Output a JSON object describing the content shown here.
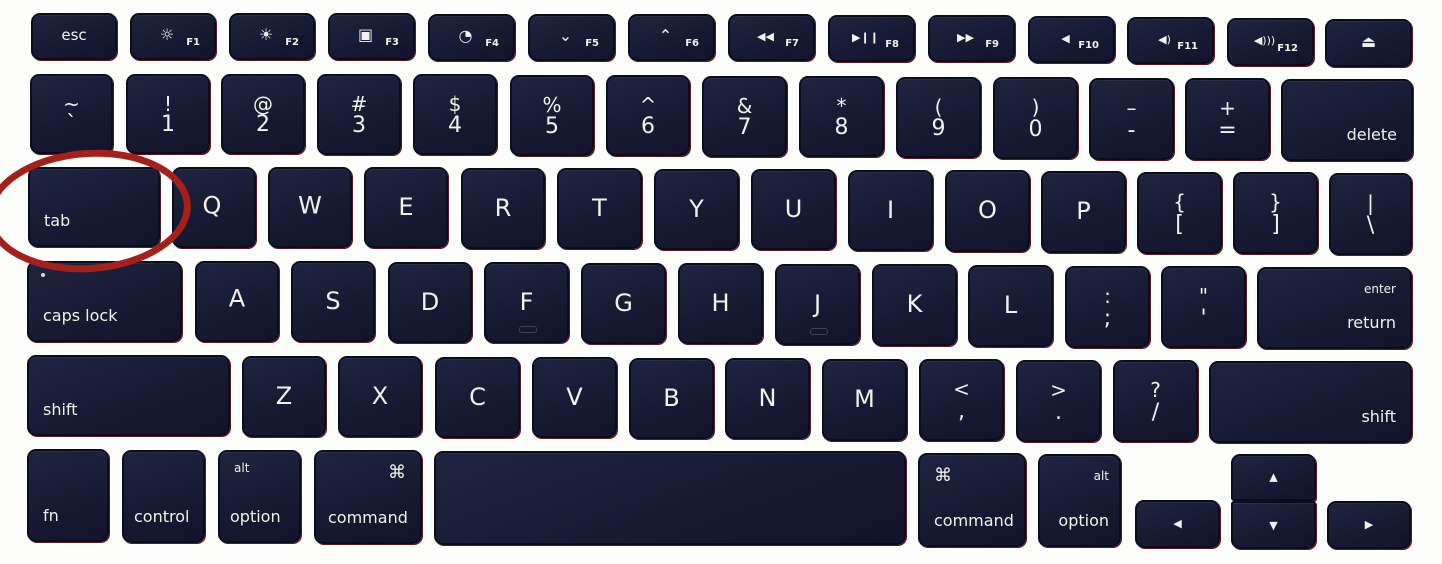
{
  "image": {
    "description": "Apple laptop keyboard (US layout) with the tab key circled in red",
    "highlight": {
      "target": "tab",
      "shape": "ellipse",
      "color": "#a4201c"
    },
    "colors": {
      "key": "#171a33",
      "legend": "#f2f1ec",
      "background": "#fdfdfb"
    }
  },
  "rows": {
    "function": [
      {
        "main": "esc",
        "fn": ""
      },
      {
        "icon": "brightness-down-icon",
        "main": "☼",
        "fn": "F1"
      },
      {
        "icon": "brightness-up-icon",
        "main": "☀",
        "fn": "F2"
      },
      {
        "icon": "expose-icon",
        "main": "▣",
        "fn": "F3"
      },
      {
        "icon": "dashboard-icon",
        "main": "◔",
        "fn": "F4"
      },
      {
        "icon": "keyboard-light-down-icon",
        "main": "⌄",
        "fn": "F5"
      },
      {
        "icon": "keyboard-light-up-icon",
        "main": "⌃",
        "fn": "F6"
      },
      {
        "icon": "rewind-icon",
        "main": "◀◀",
        "fn": "F7"
      },
      {
        "icon": "play-pause-icon",
        "main": "▶❙❙",
        "fn": "F8"
      },
      {
        "icon": "fast-forward-icon",
        "main": "▶▶",
        "fn": "F9"
      },
      {
        "icon": "mute-icon",
        "main": "◀",
        "fn": "F10"
      },
      {
        "icon": "volume-down-icon",
        "main": "◀)",
        "fn": "F11"
      },
      {
        "icon": "volume-up-icon",
        "main": "◀)))",
        "fn": "F12"
      },
      {
        "icon": "eject-icon",
        "main": "⏏",
        "fn": ""
      }
    ],
    "number": [
      {
        "top": "~",
        "bottom": "`"
      },
      {
        "top": "!",
        "bottom": "1"
      },
      {
        "top": "@",
        "bottom": "2"
      },
      {
        "top": "#",
        "bottom": "3"
      },
      {
        "top": "$",
        "bottom": "4"
      },
      {
        "top": "%",
        "bottom": "5"
      },
      {
        "top": "^",
        "bottom": "6"
      },
      {
        "top": "&",
        "bottom": "7"
      },
      {
        "top": "*",
        "bottom": "8"
      },
      {
        "top": "(",
        "bottom": "9"
      },
      {
        "top": ")",
        "bottom": "0"
      },
      {
        "top": "–",
        "bottom": "-"
      },
      {
        "top": "+",
        "bottom": "="
      },
      {
        "label": "delete"
      }
    ],
    "qwerty": [
      {
        "label": "tab"
      },
      {
        "letter": "Q"
      },
      {
        "letter": "W"
      },
      {
        "letter": "E"
      },
      {
        "letter": "R"
      },
      {
        "letter": "T"
      },
      {
        "letter": "Y"
      },
      {
        "letter": "U"
      },
      {
        "letter": "I"
      },
      {
        "letter": "O"
      },
      {
        "letter": "P"
      },
      {
        "top": "{",
        "bottom": "["
      },
      {
        "top": "}",
        "bottom": "]"
      },
      {
        "top": "|",
        "bottom": "\\"
      }
    ],
    "home": [
      {
        "label": "caps lock"
      },
      {
        "letter": "A"
      },
      {
        "letter": "S"
      },
      {
        "letter": "D"
      },
      {
        "letter": "F"
      },
      {
        "letter": "G"
      },
      {
        "letter": "H"
      },
      {
        "letter": "J"
      },
      {
        "letter": "K"
      },
      {
        "letter": "L"
      },
      {
        "top": ":",
        "bottom": ";"
      },
      {
        "top": "\"",
        "bottom": "'"
      },
      {
        "top_label": "enter",
        "label": "return"
      }
    ],
    "shift": [
      {
        "label": "shift"
      },
      {
        "letter": "Z"
      },
      {
        "letter": "X"
      },
      {
        "letter": "C"
      },
      {
        "letter": "V"
      },
      {
        "letter": "B"
      },
      {
        "letter": "N"
      },
      {
        "letter": "M"
      },
      {
        "top": "<",
        "bottom": ","
      },
      {
        "top": ">",
        "bottom": "."
      },
      {
        "top": "?",
        "bottom": "/"
      },
      {
        "label": "shift"
      }
    ],
    "bottom": [
      {
        "label": "fn"
      },
      {
        "label": "control"
      },
      {
        "top_label": "alt",
        "label": "option"
      },
      {
        "top_label": "⌘",
        "label": "command"
      },
      {
        "label": ""
      },
      {
        "top_label": "⌘",
        "label": "command"
      },
      {
        "top_label": "alt",
        "label": "option"
      },
      {
        "arrow": "◀"
      },
      {
        "arrow": "▲"
      },
      {
        "arrow": "▼"
      },
      {
        "arrow": "▶"
      }
    ]
  }
}
